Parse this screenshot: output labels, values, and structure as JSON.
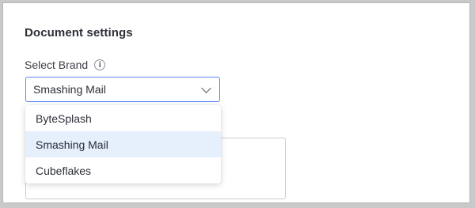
{
  "section": {
    "title": "Document settings"
  },
  "brand": {
    "label": "Select Brand",
    "info_icon": "i",
    "selected": "Smashing Mail",
    "options": [
      "ByteSplash",
      "Smashing Mail",
      "Cubeflakes"
    ],
    "accent_color": "#5b84ff",
    "highlight_color": "#e6effc"
  }
}
